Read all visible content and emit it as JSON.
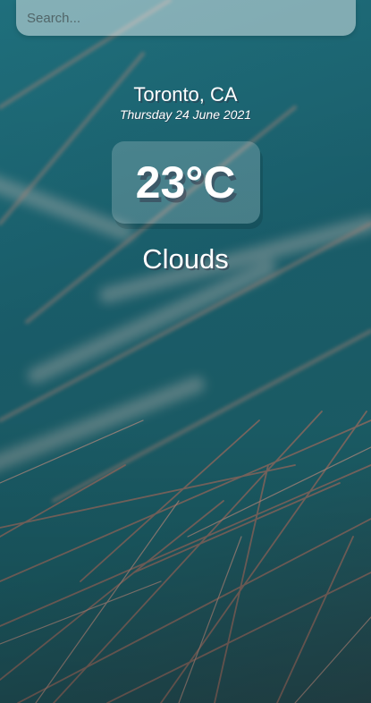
{
  "search": {
    "placeholder": "Search...",
    "value": ""
  },
  "location": {
    "city": "Toronto, CA",
    "date": "Thursday 24 June 2021"
  },
  "weather": {
    "temperature": "23°C",
    "condition": "Clouds"
  },
  "colors": {
    "background": "#1f6f7c",
    "grass": "#8a6a62"
  }
}
